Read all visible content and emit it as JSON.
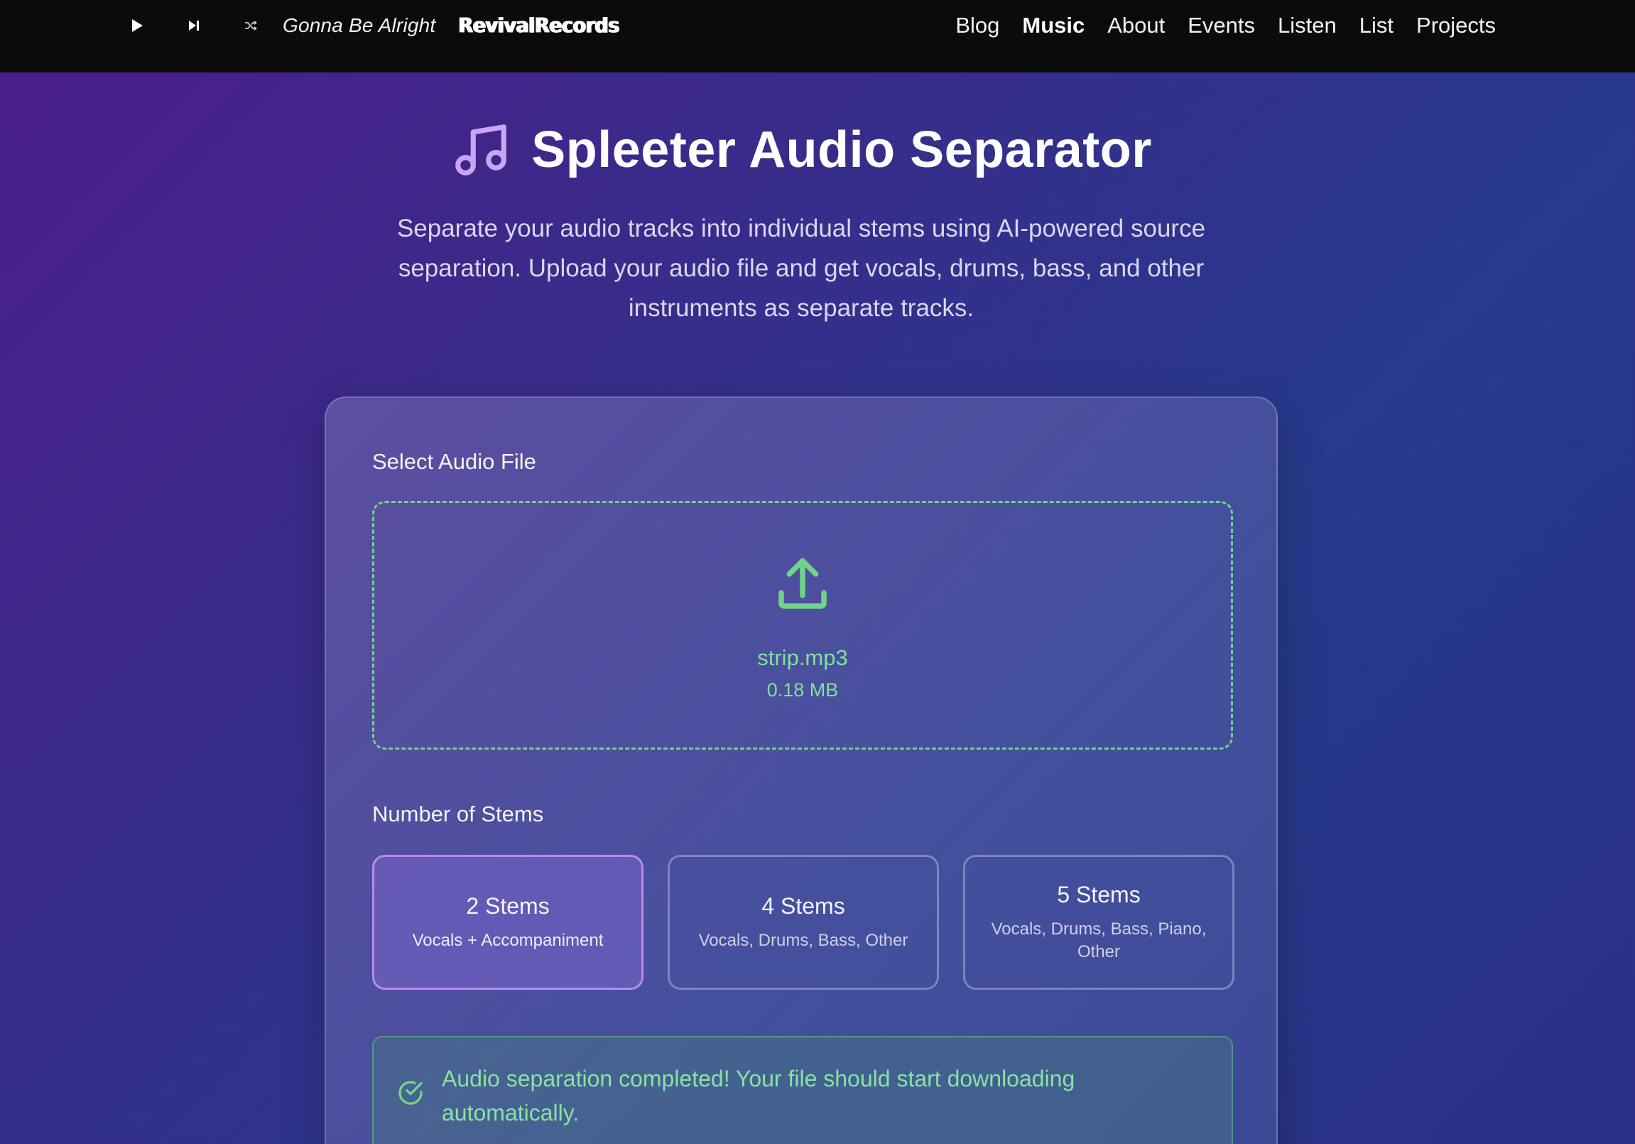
{
  "player": {
    "track_title": "Gonna Be Alright",
    "brand": "RevivalRecords",
    "icons": [
      "play-icon",
      "skip-next-icon",
      "shuffle-icon"
    ]
  },
  "nav": {
    "items": [
      "Blog",
      "Music",
      "About",
      "Events",
      "Listen",
      "List",
      "Projects"
    ],
    "active": "Music"
  },
  "hero": {
    "title": "Spleeter Audio Separator",
    "subtitle": "Separate your audio tracks into individual stems using AI-powered source separation. Upload your audio file and get vocals, drums, bass, and other instruments as separate tracks."
  },
  "form": {
    "file_label": "Select Audio File",
    "file_name": "strip.mp3",
    "file_size": "0.18 MB",
    "stems_label": "Number of Stems",
    "stem_options": [
      {
        "title": "2 Stems",
        "desc": "Vocals + Accompaniment",
        "selected": true
      },
      {
        "title": "4 Stems",
        "desc": "Vocals, Drums, Bass, Other",
        "selected": false
      },
      {
        "title": "5 Stems",
        "desc": "Vocals, Drums, Bass, Piano, Other",
        "selected": false
      }
    ]
  },
  "status": {
    "message": "Audio separation completed! Your file should start downloading automatically."
  },
  "colors": {
    "accent_green": "#6fd38a",
    "accent_purple": "#b78af0",
    "topbar_bg": "#0b0b0b"
  }
}
